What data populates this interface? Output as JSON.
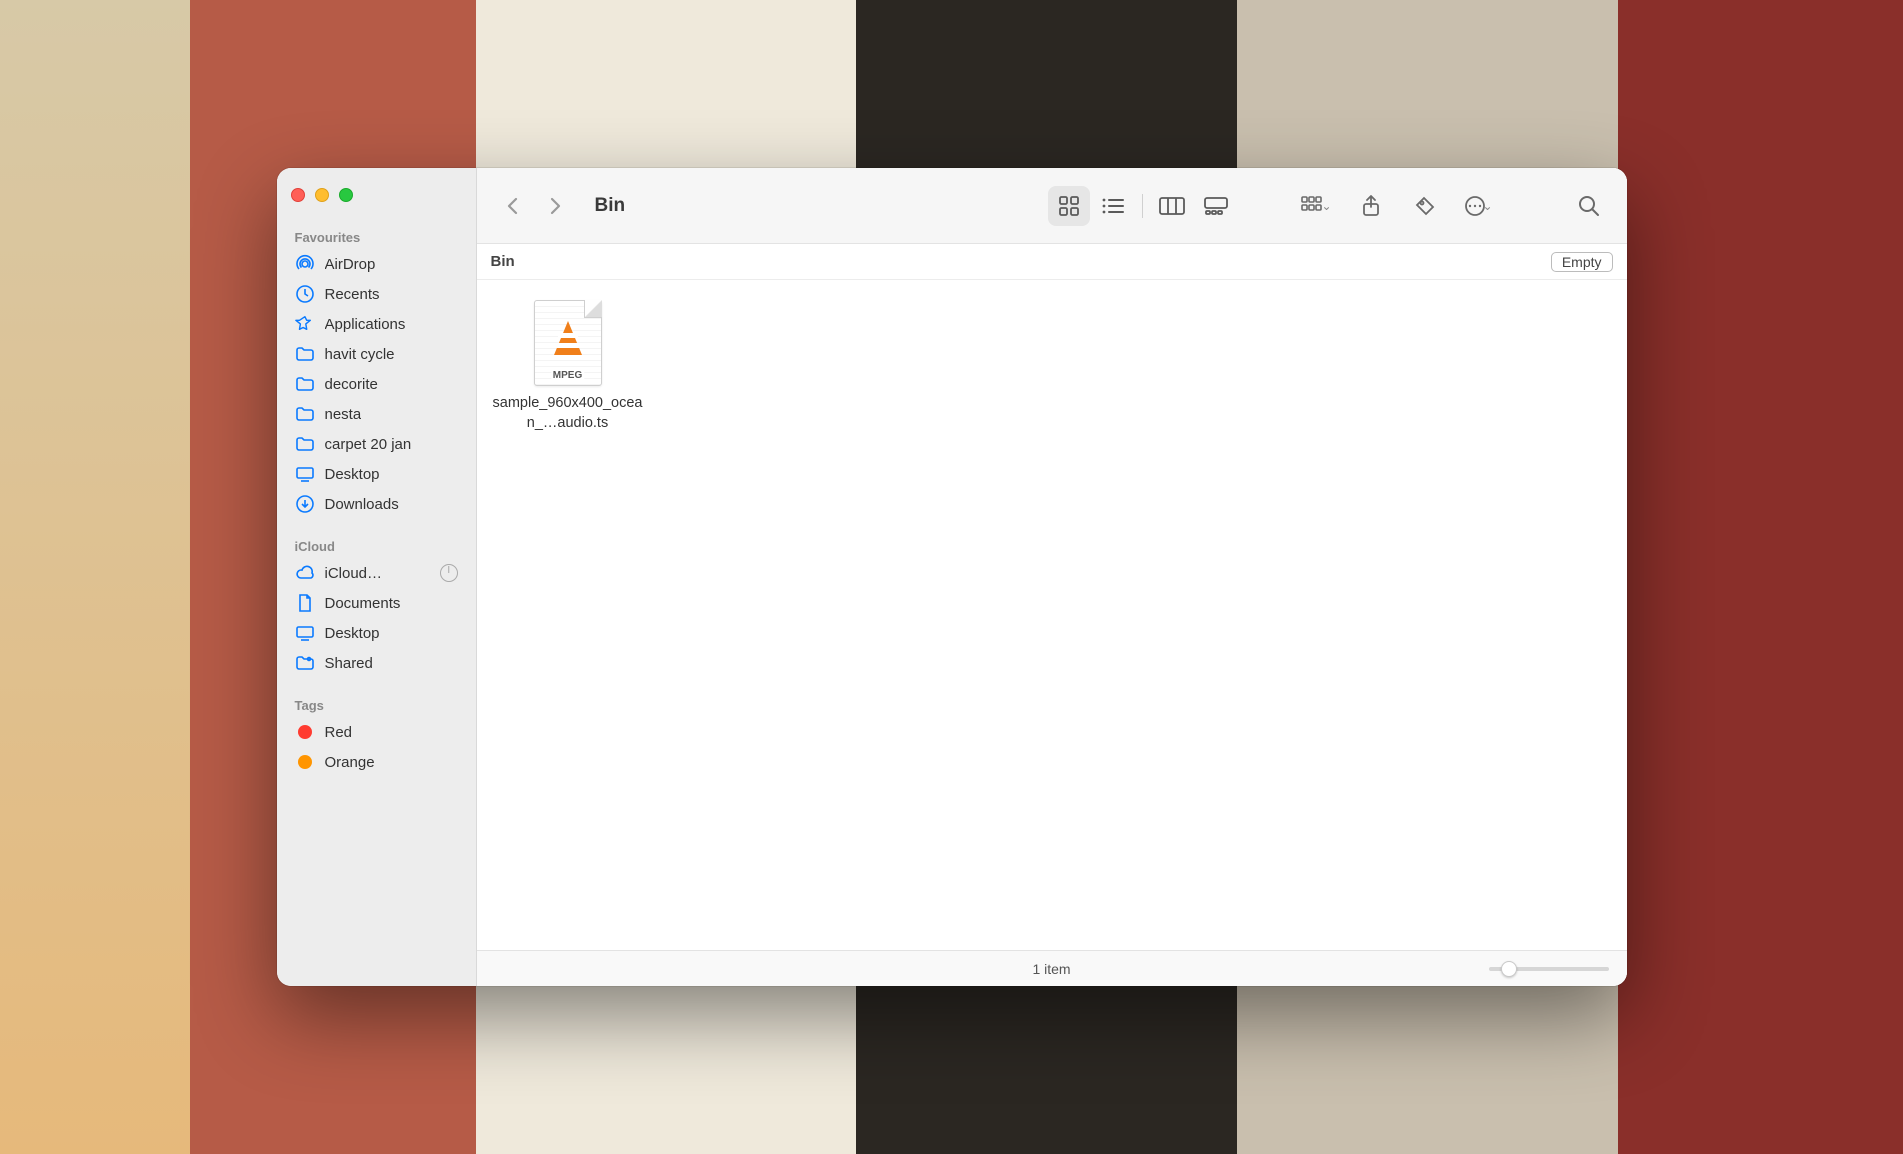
{
  "window": {
    "title": "Bin"
  },
  "sidebar": {
    "sections": [
      {
        "label": "Favourites",
        "items": [
          {
            "icon": "airdrop",
            "label": "AirDrop"
          },
          {
            "icon": "clock",
            "label": "Recents"
          },
          {
            "icon": "apps",
            "label": "Applications"
          },
          {
            "icon": "folder",
            "label": "havit cycle"
          },
          {
            "icon": "folder",
            "label": "decorite"
          },
          {
            "icon": "folder",
            "label": "nesta"
          },
          {
            "icon": "folder",
            "label": "carpet 20 jan"
          },
          {
            "icon": "desktop",
            "label": "Desktop"
          },
          {
            "icon": "download",
            "label": "Downloads"
          }
        ]
      },
      {
        "label": "iCloud",
        "items": [
          {
            "icon": "cloud",
            "label": "iCloud…",
            "progress": true
          },
          {
            "icon": "document",
            "label": "Documents"
          },
          {
            "icon": "desktop",
            "label": "Desktop"
          },
          {
            "icon": "shared",
            "label": "Shared"
          }
        ]
      },
      {
        "label": "Tags",
        "items": [
          {
            "icon": "tag",
            "color": "#ff3b30",
            "label": "Red"
          },
          {
            "icon": "tag",
            "color": "#ff9500",
            "label": "Orange"
          }
        ]
      }
    ]
  },
  "pathbar": {
    "location": "Bin",
    "empty_label": "Empty"
  },
  "files": [
    {
      "name": "sample_960x400_ocean_…audio.ts",
      "format": "MPEG"
    }
  ],
  "statusbar": {
    "count": "1 item"
  }
}
